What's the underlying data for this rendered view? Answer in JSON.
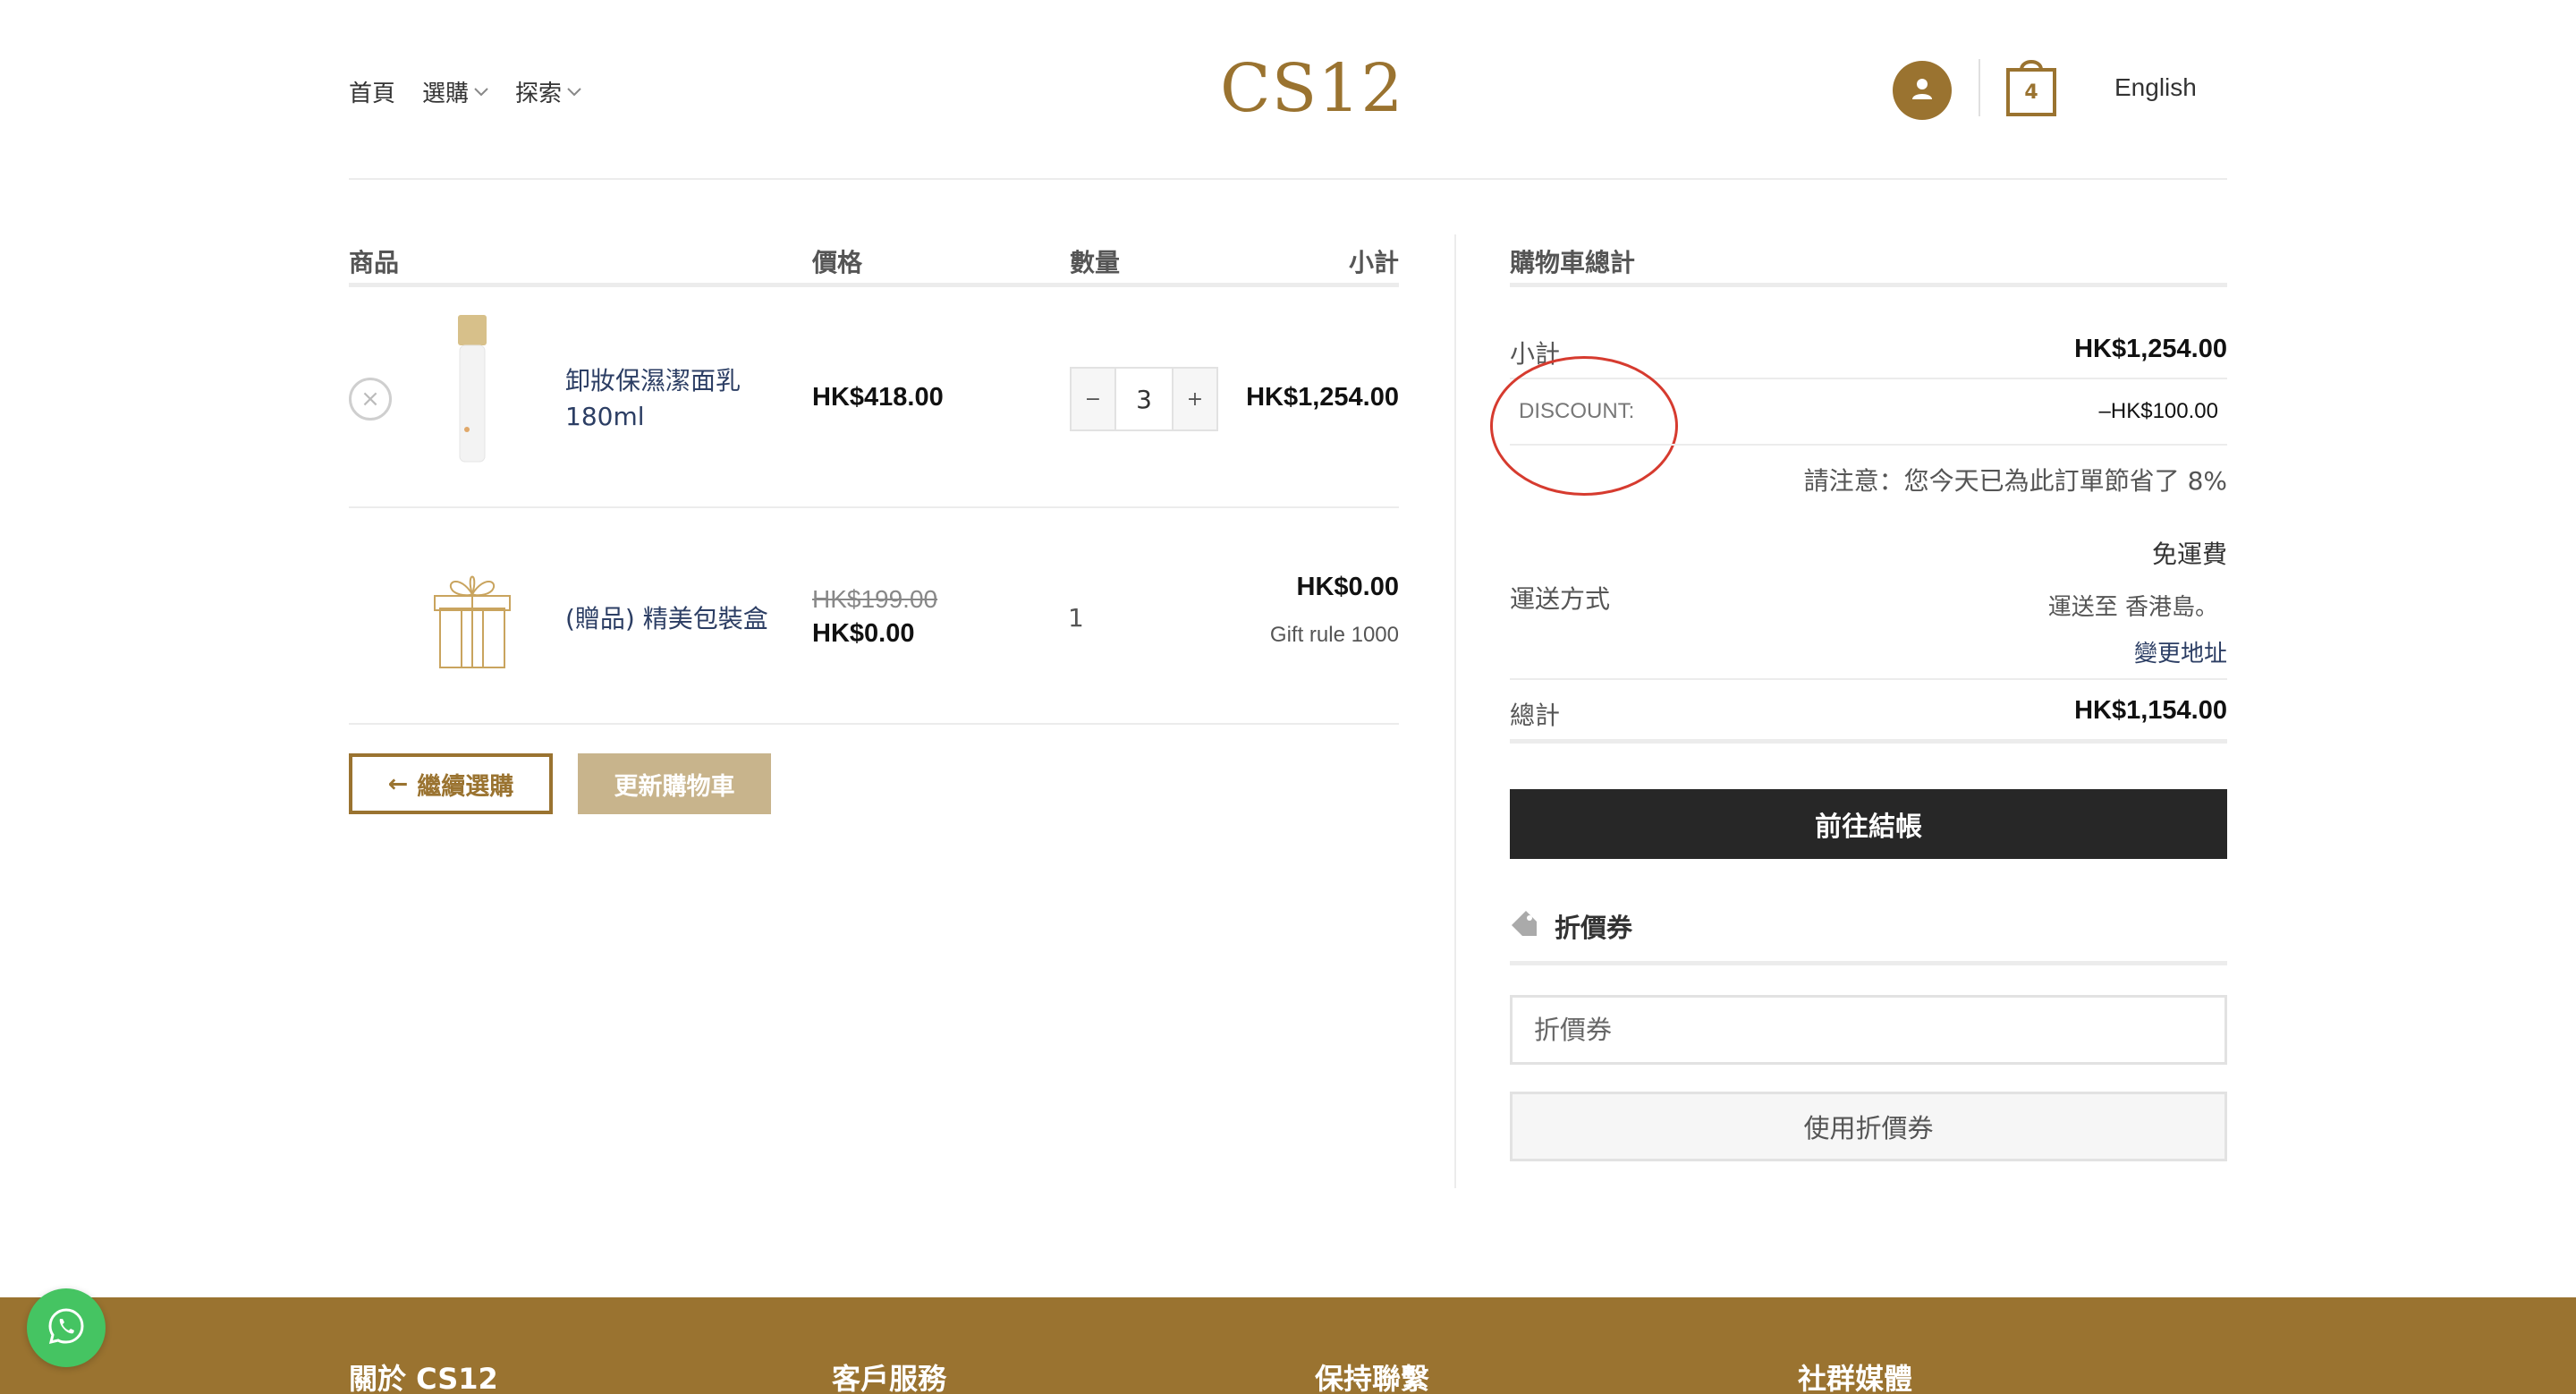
{
  "header": {
    "nav": [
      {
        "label": "首頁",
        "has_dropdown": false
      },
      {
        "label": "選購",
        "has_dropdown": true
      },
      {
        "label": "探索",
        "has_dropdown": true
      }
    ],
    "logo": "CS12",
    "cart_count": "4",
    "language": "English"
  },
  "cart": {
    "columns": {
      "product": "商品",
      "price": "價格",
      "quantity": "數量",
      "subtotal": "小計"
    },
    "items": [
      {
        "name": "卸妝保濕潔面乳 180ml",
        "price": "HK$418.00",
        "quantity": "3",
        "subtotal": "HK$1,254.00",
        "remove_icon": "close-icon"
      },
      {
        "name": "(贈品) 精美包裝盒",
        "old_price": "HK$199.00",
        "price": "HK$0.00",
        "quantity": "1",
        "subtotal": "HK$0.00",
        "note": "Gift rule 1000"
      }
    ],
    "qty_minus": "−",
    "qty_plus": "+",
    "continue_label": "繼續選購",
    "continue_arrow": "←",
    "update_label": "更新購物車"
  },
  "totals": {
    "title": "購物車總計",
    "subtotal_label": "小計",
    "subtotal_value": "HK$1,254.00",
    "discount_label": "DISCOUNT:",
    "discount_value": "–HK$100.00",
    "saving_note": "請注意：您今天已為此訂單節省了 8%",
    "shipping_label": "運送方式",
    "shipping_method": "免運費",
    "shipping_to": "運送至 香港島。",
    "change_address": "變更地址",
    "total_label": "總計",
    "total_value": "HK$1,154.00",
    "checkout_label": "前往結帳"
  },
  "coupon": {
    "title": "折價券",
    "icon": "tag-icon",
    "placeholder": "折價券",
    "apply_label": "使用折價券"
  },
  "footer": {
    "columns": [
      "關於 CS12",
      "客戶服務",
      "保持聯繫",
      "社群媒體"
    ]
  },
  "colors": {
    "brand_gold": "#9a7330",
    "checkout_dark": "#272727",
    "update_button": "#c8b48c",
    "whatsapp_green": "#45c462",
    "annotation_red": "#d63b2f"
  }
}
